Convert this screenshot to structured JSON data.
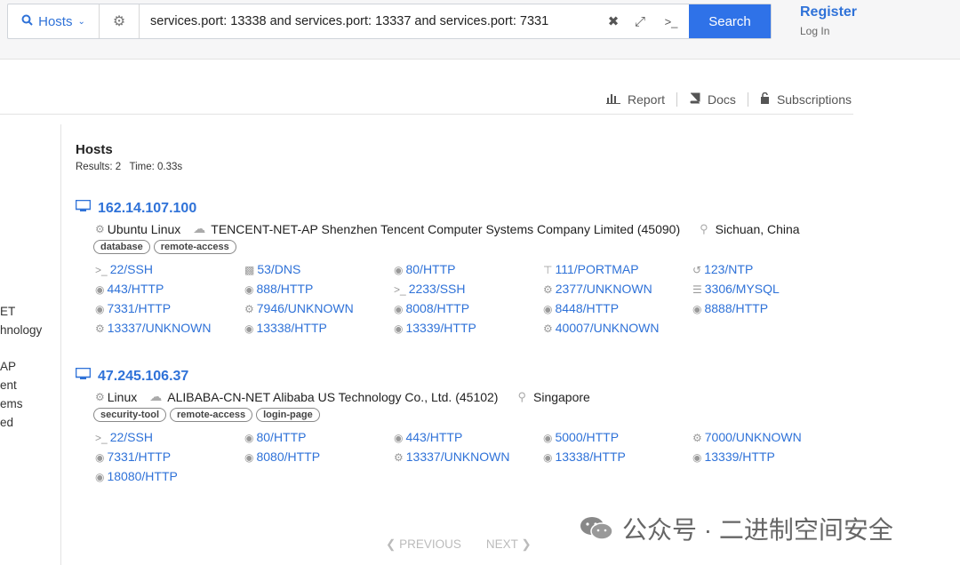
{
  "search": {
    "scope": "Hosts",
    "query": "services.port: 13338 and services.port: 13337 and services.port: 7331",
    "button": "Search"
  },
  "account": {
    "register": "Register",
    "login": "Log In"
  },
  "toolbar": {
    "report": "Report",
    "docs": "Docs",
    "subscriptions": "Subscriptions"
  },
  "sidebar_fragments": [
    "ET",
    "hnology",
    "",
    "AP",
    "ent",
    "ems",
    "ed"
  ],
  "results": {
    "title": "Hosts",
    "summary": "Results: 2   Time: 0.33s"
  },
  "hosts": [
    {
      "ip": "162.14.107.100",
      "os": "Ubuntu Linux",
      "network": "TENCENT-NET-AP Shenzhen Tencent Computer Systems Company Limited (45090)",
      "location": "Sichuan, China",
      "tags": [
        "database",
        "remote-access"
      ],
      "services": [
        {
          "label": "22/SSH",
          "icon": "terminal-icon"
        },
        {
          "label": "53/DNS",
          "icon": "dns-icon"
        },
        {
          "label": "80/HTTP",
          "icon": "globe-icon"
        },
        {
          "label": "111/PORTMAP",
          "icon": "portmap-icon"
        },
        {
          "label": "123/NTP",
          "icon": "clock-icon"
        },
        {
          "label": "443/HTTP",
          "icon": "globe-icon"
        },
        {
          "label": "888/HTTP",
          "icon": "globe-icon"
        },
        {
          "label": "2233/SSH",
          "icon": "terminal-icon"
        },
        {
          "label": "2377/UNKNOWN",
          "icon": "gear-icon"
        },
        {
          "label": "3306/MYSQL",
          "icon": "database-icon"
        },
        {
          "label": "7331/HTTP",
          "icon": "globe-icon"
        },
        {
          "label": "7946/UNKNOWN",
          "icon": "gear-icon"
        },
        {
          "label": "8008/HTTP",
          "icon": "globe-icon"
        },
        {
          "label": "8448/HTTP",
          "icon": "globe-icon"
        },
        {
          "label": "8888/HTTP",
          "icon": "globe-icon"
        },
        {
          "label": "13337/UNKNOWN",
          "icon": "gear-icon"
        },
        {
          "label": "13338/HTTP",
          "icon": "globe-icon"
        },
        {
          "label": "13339/HTTP",
          "icon": "globe-icon"
        },
        {
          "label": "40007/UNKNOWN",
          "icon": "gear-icon"
        }
      ]
    },
    {
      "ip": "47.245.106.37",
      "os": "Linux",
      "network": "ALIBABA-CN-NET Alibaba US Technology Co., Ltd. (45102)",
      "location": "Singapore",
      "tags": [
        "security-tool",
        "remote-access",
        "login-page"
      ],
      "services": [
        {
          "label": "22/SSH",
          "icon": "terminal-icon"
        },
        {
          "label": "80/HTTP",
          "icon": "globe-icon"
        },
        {
          "label": "443/HTTP",
          "icon": "globe-icon"
        },
        {
          "label": "5000/HTTP",
          "icon": "globe-icon"
        },
        {
          "label": "7000/UNKNOWN",
          "icon": "gear-icon"
        },
        {
          "label": "7331/HTTP",
          "icon": "globe-icon"
        },
        {
          "label": "8080/HTTP",
          "icon": "globe-icon"
        },
        {
          "label": "13337/UNKNOWN",
          "icon": "gear-icon"
        },
        {
          "label": "13338/HTTP",
          "icon": "globe-icon"
        },
        {
          "label": "13339/HTTP",
          "icon": "globe-icon"
        },
        {
          "label": "18080/HTTP",
          "icon": "globe-icon"
        }
      ]
    }
  ],
  "pagination": {
    "previous": "PREVIOUS",
    "next": "NEXT"
  },
  "watermark": "公众号 · 二进制空间安全",
  "colors": {
    "link": "#2f72d8",
    "button": "#2f72e8"
  }
}
